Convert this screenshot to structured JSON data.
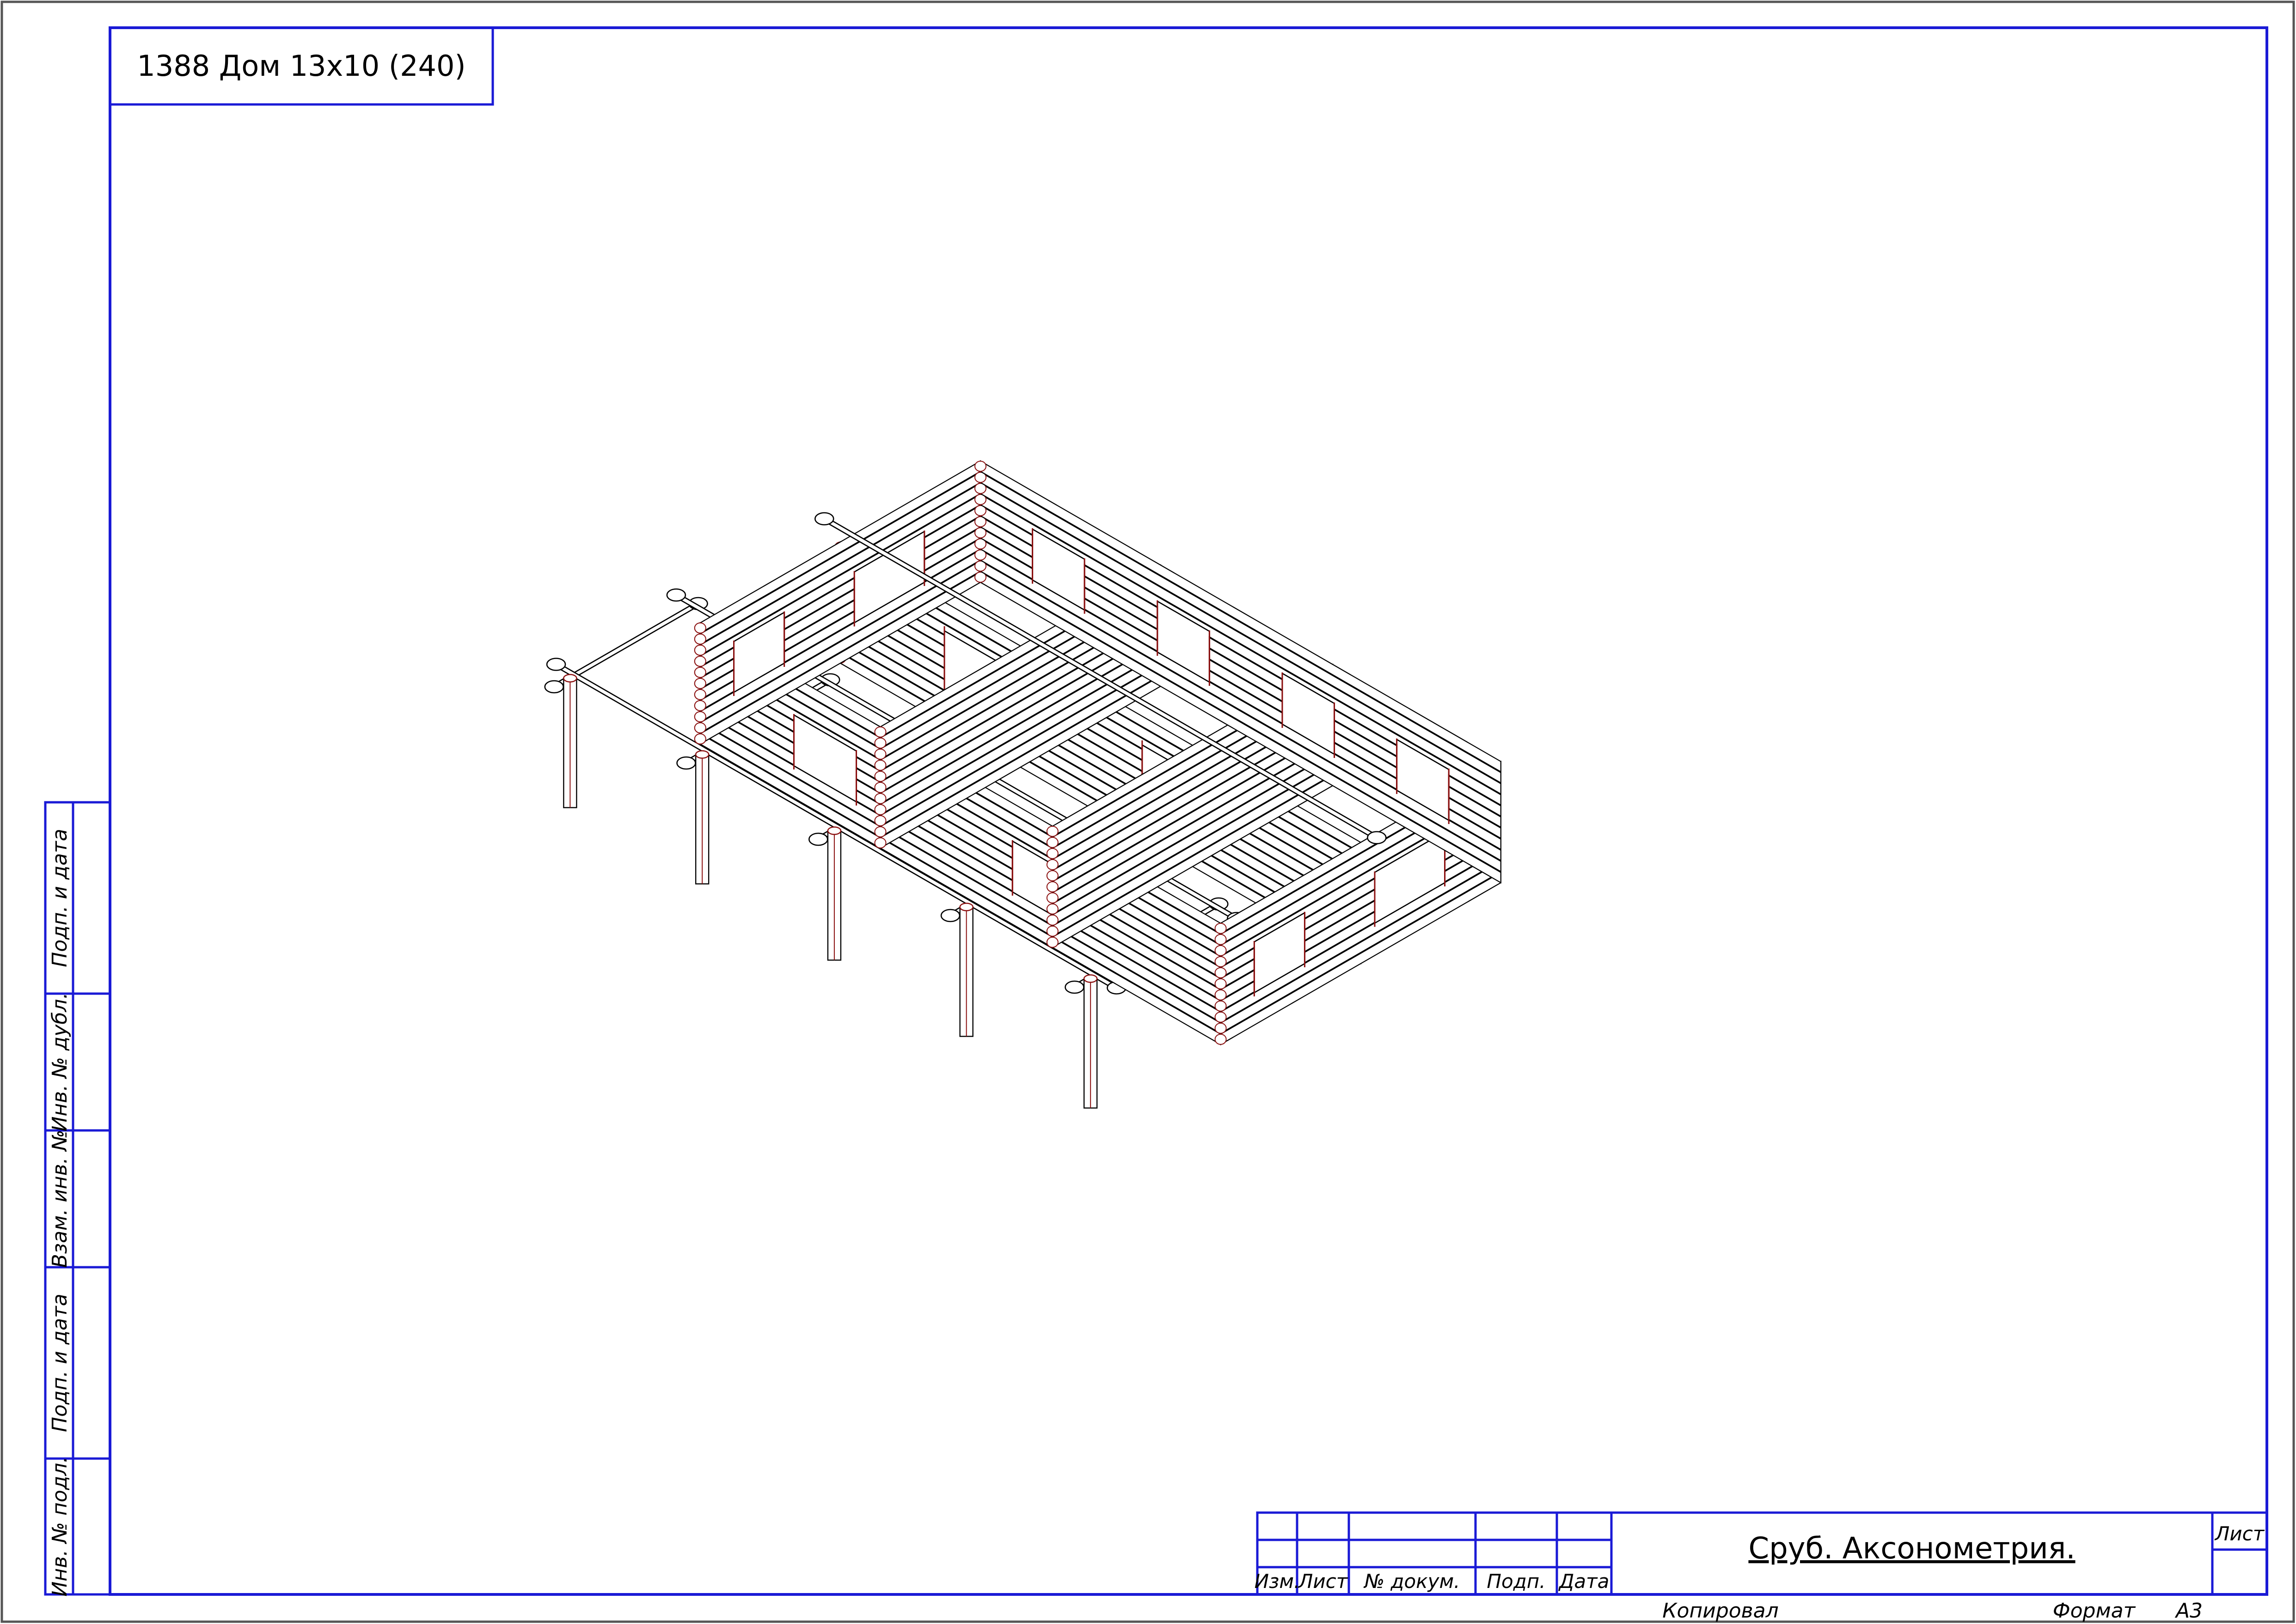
{
  "project_label": "1388 Дом 13х10 (240)",
  "side_stamp": [
    "Подп. и дата",
    "Инв. № дубл.",
    "Взам. инв. №",
    "Подп. и дата",
    "Инв. № подл."
  ],
  "title_block": {
    "headers": [
      "Изм.",
      "Лист",
      "№ докум.",
      "Подп.",
      "Дата"
    ],
    "drawing_title": "Сруб. Аксонометрия.",
    "sheet_label": "Лист",
    "copied_label": "Копировал",
    "format_label": "Формат",
    "format_value": "А3"
  },
  "colors": {
    "frame": "#1a1ad6",
    "line": "#000000",
    "log_end": "#8b1010",
    "page": "#ffffff"
  }
}
